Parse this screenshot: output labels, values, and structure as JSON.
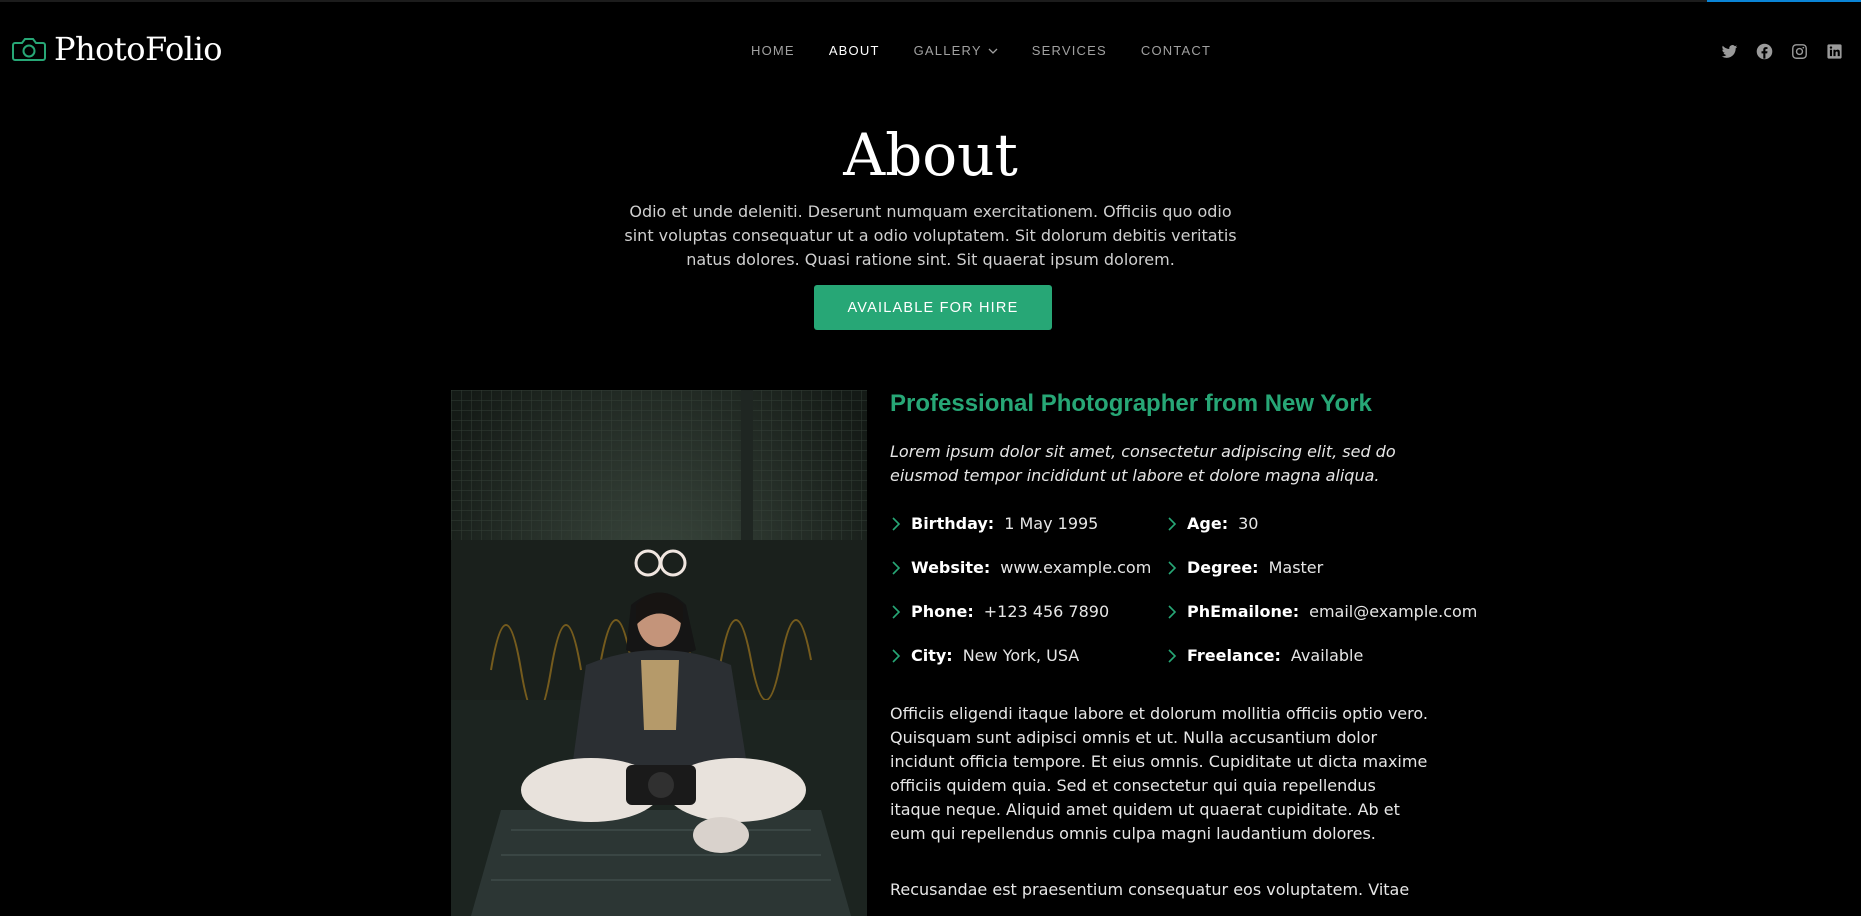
{
  "brand": {
    "name": "PhotoFolio",
    "accent_color": "#27a776",
    "icon": "camera-icon"
  },
  "nav": {
    "items": [
      {
        "label": "HOME"
      },
      {
        "label": "ABOUT",
        "active": true
      },
      {
        "label": "GALLERY",
        "has_dropdown": true
      },
      {
        "label": "SERVICES"
      },
      {
        "label": "CONTACT"
      }
    ]
  },
  "social": [
    "twitter-icon",
    "facebook-icon",
    "instagram-icon",
    "linkedin-icon"
  ],
  "hero": {
    "title": "About",
    "description": "Odio et unde deleniti. Deserunt numquam exercitationem. Officiis quo odio sint voluptas consequatur ut a odio voluptatem. Sit dolorum debitis veritatis natus dolores. Quasi ratione sint. Sit quaerat ipsum dolorem.",
    "button_label": "AVAILABLE FOR HIRE"
  },
  "about": {
    "heading": "Professional Photographer from New York",
    "lead": "Lorem ipsum dolor sit amet, consectetur adipiscing elit, sed do eiusmod tempor incididunt ut labore et dolore magna aliqua.",
    "details": [
      {
        "label": "Birthday:",
        "value": "1 May 1995"
      },
      {
        "label": "Age:",
        "value": "30"
      },
      {
        "label": "Website:",
        "value": "www.example.com"
      },
      {
        "label": "Degree:",
        "value": "Master"
      },
      {
        "label": "Phone:",
        "value": "+123 456 7890"
      },
      {
        "label": "PhEmailone:",
        "value": "email@example.com"
      },
      {
        "label": "City:",
        "value": "New York, USA"
      },
      {
        "label": "Freelance:",
        "value": "Available"
      }
    ],
    "paragraph_1": "Officiis eligendi itaque labore et dolorum mollitia officiis optio vero. Quisquam sunt adipisci omnis et ut. Nulla accusantium dolor incidunt officia tempore. Et eius omnis. Cupiditate ut dicta maxime officiis quidem quia. Sed et consectetur qui quia repellendus itaque neque. Aliquid amet quidem ut quaerat cupiditate. Ab et eum qui repellendus omnis culpa magni laudantium dolores.",
    "paragraph_2": "Recusandae est praesentium consequatur eos voluptatem. Vitae"
  }
}
